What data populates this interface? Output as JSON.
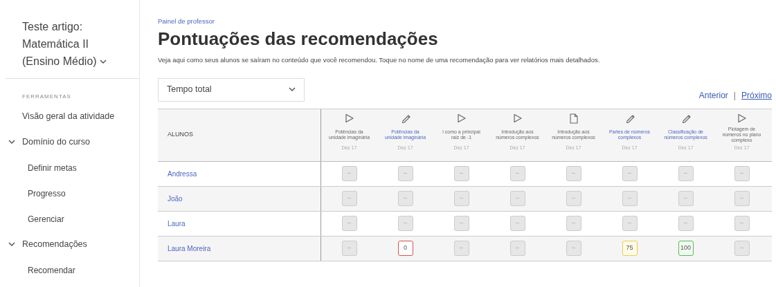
{
  "sidebar": {
    "course_title": "Teste artigo: Matemática II (Ensino Médio)",
    "section_label": "FERRAMENTAS",
    "items": [
      {
        "label": "Visão geral da atividade"
      },
      {
        "label": "Domínio do curso",
        "expanded": true,
        "children": [
          {
            "label": "Definir metas"
          },
          {
            "label": "Progresso"
          },
          {
            "label": "Gerenciar"
          }
        ]
      },
      {
        "label": "Recomendações",
        "expanded": true,
        "children": [
          {
            "label": "Recomendar"
          }
        ]
      }
    ]
  },
  "breadcrumb": "Painel de professor",
  "title": "Pontuações das recomendações",
  "description": "Veja aqui como seus alunos se saíram no conteúdo que você recomendou. Toque no nome de uma recomendação para ver relatórios mais detalhados.",
  "metric_select": {
    "value": "Tempo total"
  },
  "pager": {
    "previous": "Anterior",
    "separator": "|",
    "next": "Próximo"
  },
  "table": {
    "first_column": "ALUNOS",
    "columns": [
      {
        "kind": "video",
        "title": "Potências da unidade imaginária",
        "linked": false,
        "date": "Dez 17"
      },
      {
        "kind": "exercise",
        "title": "Potências da unidade imaginária",
        "linked": true,
        "date": "Dez 17"
      },
      {
        "kind": "video",
        "title": "i como a principal raiz de -1",
        "linked": false,
        "date": "Dez 17"
      },
      {
        "kind": "video",
        "title": "Introdução aos números complexos",
        "linked": false,
        "date": "Dez 17"
      },
      {
        "kind": "article",
        "title": "Introdução aos números complexos",
        "linked": false,
        "date": "Dez 17"
      },
      {
        "kind": "exercise",
        "title": "Partes de números complexos",
        "linked": true,
        "date": "Dez 17"
      },
      {
        "kind": "exercise",
        "title": "Classificação de números complexos",
        "linked": true,
        "date": "Dez 17"
      },
      {
        "kind": "video",
        "title": "Plotagem de números no plano complexo",
        "linked": false,
        "date": "Dez 17"
      }
    ],
    "rows": [
      {
        "student": "Andressa",
        "cells": [
          {
            "text": "–",
            "kind": "empty"
          },
          {
            "text": "–",
            "kind": "empty"
          },
          {
            "text": "–",
            "kind": "empty"
          },
          {
            "text": "–",
            "kind": "empty"
          },
          {
            "text": "–",
            "kind": "empty"
          },
          {
            "text": "–",
            "kind": "empty"
          },
          {
            "text": "–",
            "kind": "empty"
          },
          {
            "text": "–",
            "kind": "empty"
          }
        ]
      },
      {
        "student": "João",
        "cells": [
          {
            "text": "–",
            "kind": "empty"
          },
          {
            "text": "–",
            "kind": "empty"
          },
          {
            "text": "–",
            "kind": "empty"
          },
          {
            "text": "–",
            "kind": "empty"
          },
          {
            "text": "–",
            "kind": "empty"
          },
          {
            "text": "–",
            "kind": "empty"
          },
          {
            "text": "–",
            "kind": "empty"
          },
          {
            "text": "–",
            "kind": "empty"
          }
        ]
      },
      {
        "student": "Laura",
        "cells": [
          {
            "text": "–",
            "kind": "empty"
          },
          {
            "text": "–",
            "kind": "empty"
          },
          {
            "text": "–",
            "kind": "empty"
          },
          {
            "text": "–",
            "kind": "empty"
          },
          {
            "text": "–",
            "kind": "empty"
          },
          {
            "text": "–",
            "kind": "empty"
          },
          {
            "text": "–",
            "kind": "empty"
          },
          {
            "text": "–",
            "kind": "empty"
          }
        ]
      },
      {
        "student": "Laura Moreira",
        "cells": [
          {
            "text": "–",
            "kind": "empty"
          },
          {
            "text": "0",
            "kind": "low"
          },
          {
            "text": "–",
            "kind": "empty"
          },
          {
            "text": "–",
            "kind": "empty"
          },
          {
            "text": "–",
            "kind": "empty"
          },
          {
            "text": "75",
            "kind": "mid"
          },
          {
            "text": "100",
            "kind": "high"
          },
          {
            "text": "–",
            "kind": "empty"
          }
        ]
      }
    ]
  }
}
